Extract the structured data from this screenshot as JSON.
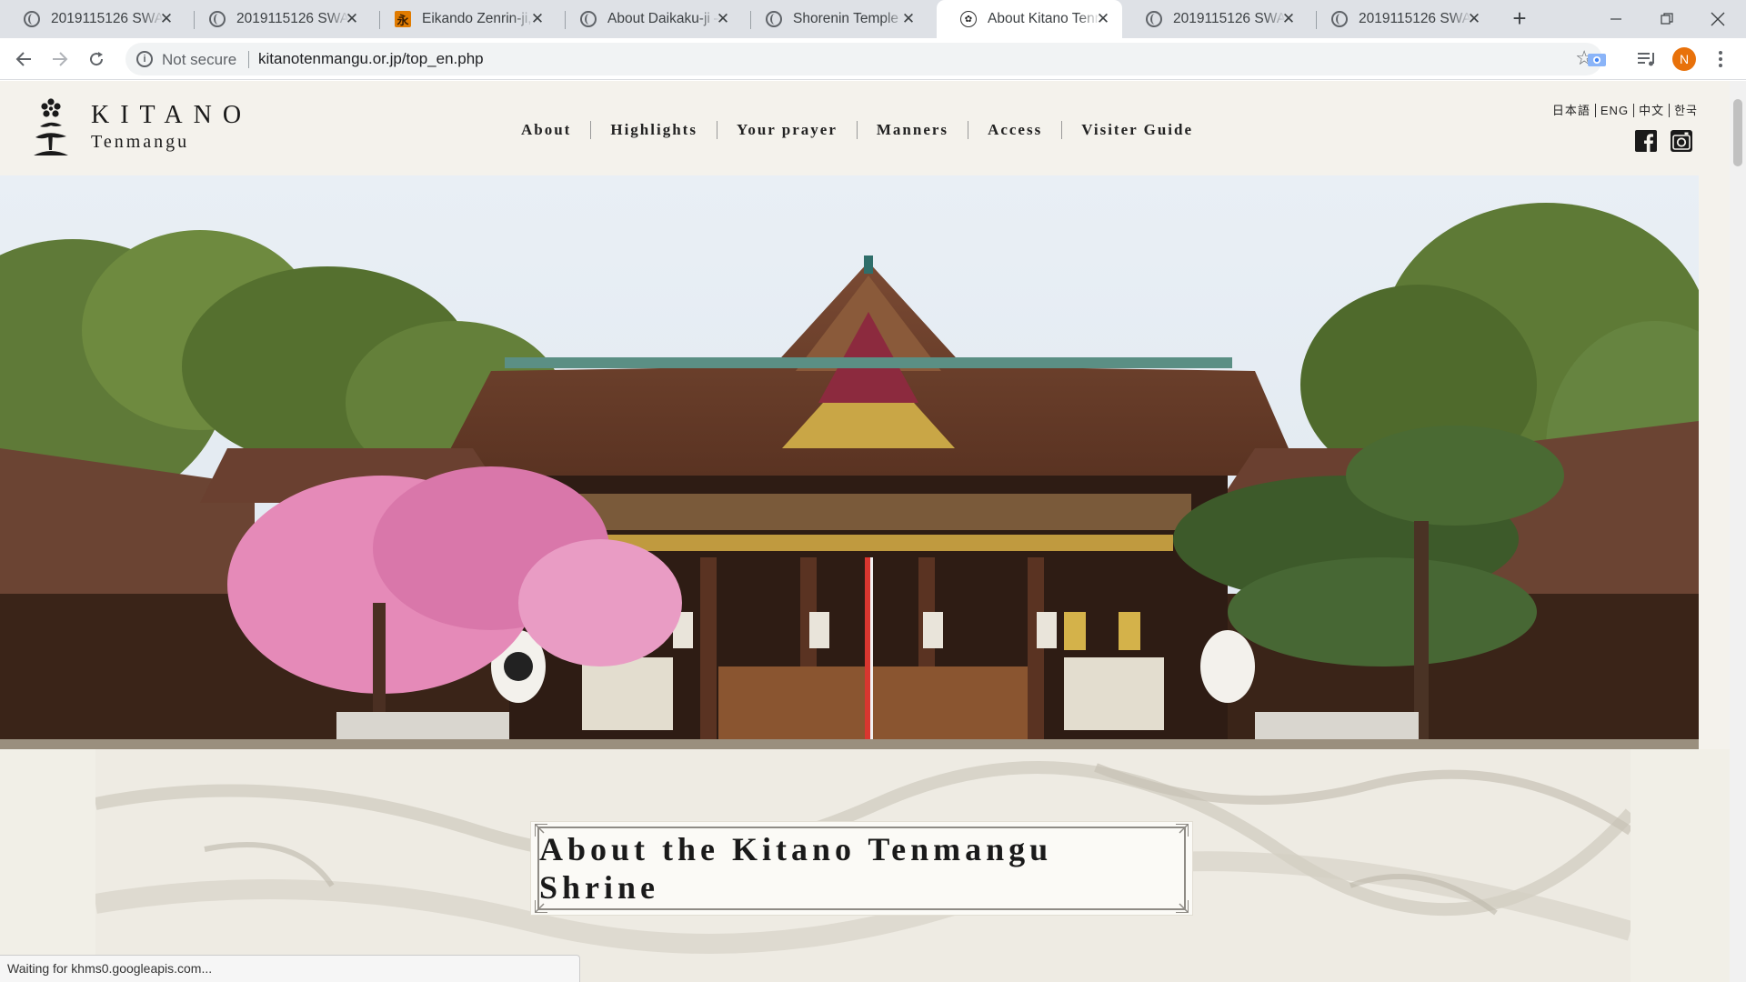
{
  "browser": {
    "tabs": [
      {
        "title": "2019115126 SWAN",
        "icon": "globe-icon",
        "active": false
      },
      {
        "title": "2019115126 SWAN",
        "icon": "globe-icon",
        "active": false
      },
      {
        "title": "Eikando Zenrin-ji, K",
        "icon": "eikando-favicon",
        "active": false
      },
      {
        "title": "About Daikaku-ji –",
        "icon": "globe-icon",
        "active": false
      },
      {
        "title": "Shorenin Temple",
        "icon": "globe-icon",
        "active": false
      },
      {
        "title": "About Kitano Tenm",
        "icon": "kitano-favicon",
        "active": true
      },
      {
        "title": "2019115126 SWAN",
        "icon": "globe-icon",
        "active": false
      },
      {
        "title": "2019115126 SWAN",
        "icon": "globe-icon",
        "active": false
      }
    ],
    "eikando_glyph": "永",
    "address": {
      "security": "Not secure",
      "url": "kitanotenmangu.or.jp/top_en.php"
    },
    "profile_initial": "N",
    "status_text": "Waiting for khms0.googleapis.com..."
  },
  "site": {
    "logo": {
      "line1": "KITANO",
      "line2": "Tenmangu"
    },
    "nav": [
      "About",
      "Highlights",
      "Your prayer",
      "Manners",
      "Access",
      "Visiter Guide"
    ],
    "languages": [
      "日本語",
      "ENG",
      "中文",
      "한국"
    ],
    "social": [
      "facebook-icon",
      "instagram-icon"
    ],
    "section_title": "About the Kitano Tenmangu Shrine"
  },
  "colors": {
    "accent_bg": "#f4f2ec",
    "profile": "#e8710a",
    "blossom": "#e58ab8",
    "roof": "#6e3f2a"
  }
}
